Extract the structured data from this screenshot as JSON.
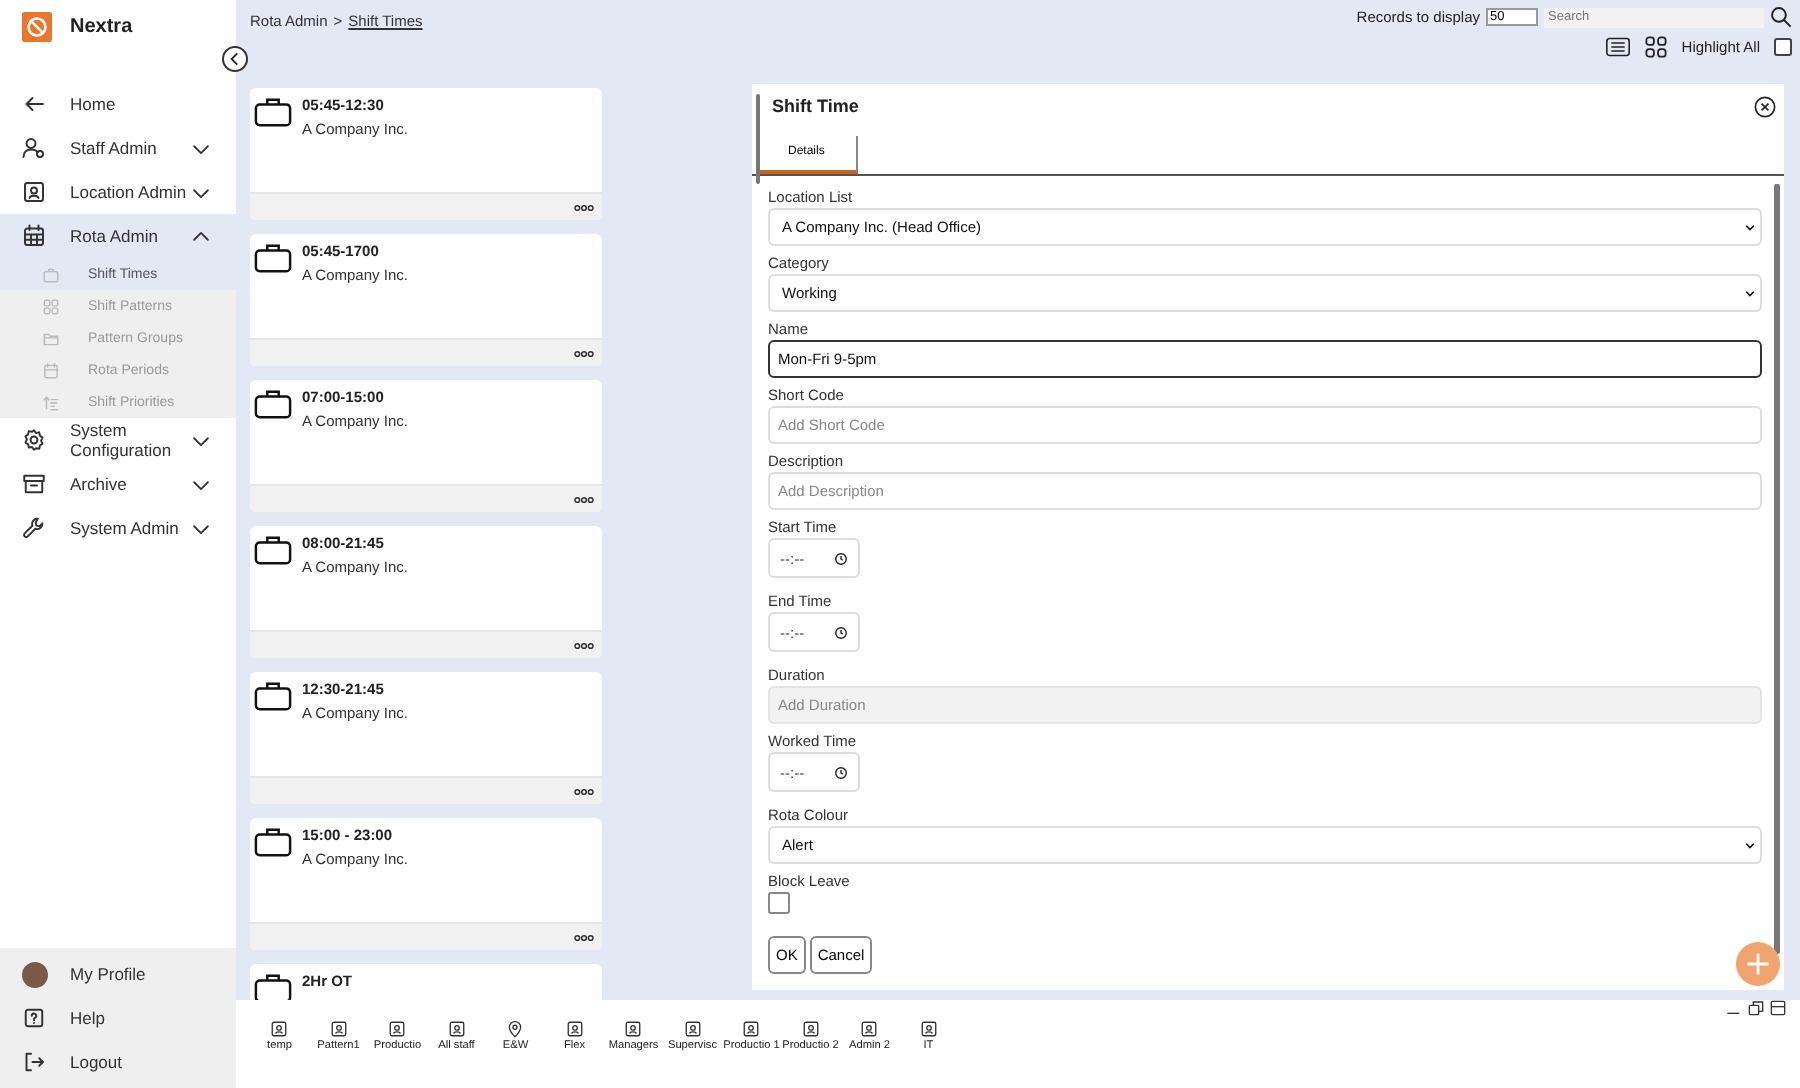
{
  "app": {
    "name": "Nextra"
  },
  "sidebar": {
    "items": [
      {
        "kind": "link",
        "label": "Home",
        "selected": false
      },
      {
        "kind": "group",
        "label": "Staff Admin",
        "expanded": false,
        "selected": false
      },
      {
        "kind": "group",
        "label": "Location Admin",
        "expanded": false,
        "selected": false
      },
      {
        "kind": "group",
        "label": "Rota Admin",
        "expanded": true,
        "selected": true,
        "children": [
          {
            "label": "Shift Times",
            "selected": true
          },
          {
            "label": "Shift Patterns",
            "selected": false
          },
          {
            "label": "Pattern Groups",
            "selected": false
          },
          {
            "label": "Rota Periods",
            "selected": false
          },
          {
            "label": "Shift Priorities",
            "selected": false
          }
        ]
      },
      {
        "kind": "group",
        "label": "System Configuration",
        "expanded": false,
        "selected": false
      },
      {
        "kind": "group",
        "label": "Archive",
        "expanded": false,
        "selected": false
      },
      {
        "kind": "group",
        "label": "System Admin",
        "expanded": false,
        "selected": false
      }
    ],
    "footer": [
      {
        "kind": "profile",
        "label": "My Profile"
      },
      {
        "kind": "help",
        "label": "Help"
      },
      {
        "kind": "logout",
        "label": "Logout"
      }
    ]
  },
  "breadcrumb": {
    "parent": "Rota Admin",
    "separator": ">",
    "current": "Shift Times"
  },
  "toolbar": {
    "records_label": "Records to display",
    "records_value": "50",
    "search_placeholder": "Search",
    "highlight_label": "Highlight All",
    "highlight_checked": false
  },
  "cards": [
    {
      "title": "05:45-12:30",
      "subtitle": "A Company Inc."
    },
    {
      "title": "05:45-1700",
      "subtitle": "A Company Inc."
    },
    {
      "title": "07:00-15:00",
      "subtitle": "A Company Inc."
    },
    {
      "title": "08:00-21:45",
      "subtitle": "A Company Inc."
    },
    {
      "title": "12:30-21:45",
      "subtitle": "A Company Inc."
    },
    {
      "title": "15:00 - 23:00",
      "subtitle": "A Company Inc."
    },
    {
      "title": "2Hr OT"
    }
  ],
  "panel": {
    "title": "Shift Time",
    "tabs": [
      {
        "label": "Details",
        "selected": true
      }
    ],
    "fields": [
      {
        "kind": "select",
        "label": "Location List",
        "value": "A Company Inc. (Head Office)"
      },
      {
        "kind": "select",
        "label": "Category",
        "value": "Working"
      },
      {
        "kind": "text",
        "label": "Name",
        "value": "Mon-Fri 9-5pm",
        "disabled": false,
        "focused": true
      },
      {
        "kind": "text",
        "label": "Short Code",
        "placeholder": "Add Short Code",
        "disabled": false,
        "focused": false
      },
      {
        "kind": "text",
        "label": "Description",
        "placeholder": "Add Description",
        "disabled": false,
        "focused": false
      },
      {
        "kind": "time",
        "label": "Start Time",
        "value": "--:--"
      },
      {
        "kind": "time",
        "label": "End Time",
        "value": "--:--"
      },
      {
        "kind": "text",
        "label": "Duration",
        "placeholder": "Add Duration",
        "disabled": true,
        "focused": false
      },
      {
        "kind": "time",
        "label": "Worked Time",
        "value": "--:--"
      },
      {
        "kind": "select",
        "label": "Rota Colour",
        "value": "Alert"
      },
      {
        "kind": "checkbox",
        "label": "Block Leave",
        "checked": false
      }
    ],
    "buttons": [
      "OK",
      "Cancel"
    ]
  },
  "tray": [
    {
      "kind": "user",
      "label": "temp"
    },
    {
      "kind": "user",
      "label": "Pattern1"
    },
    {
      "kind": "user",
      "label": "Productio"
    },
    {
      "kind": "user",
      "label": "All staff"
    },
    {
      "kind": "location",
      "label": "E&W"
    },
    {
      "kind": "user",
      "label": "Flex"
    },
    {
      "kind": "user",
      "label": "Managers"
    },
    {
      "kind": "user",
      "label": "Supervisc"
    },
    {
      "kind": "user",
      "label": "Productio 1"
    },
    {
      "kind": "user",
      "label": "Productio 2"
    },
    {
      "kind": "user",
      "label": "Admin 2"
    },
    {
      "kind": "user",
      "label": "IT"
    }
  ]
}
